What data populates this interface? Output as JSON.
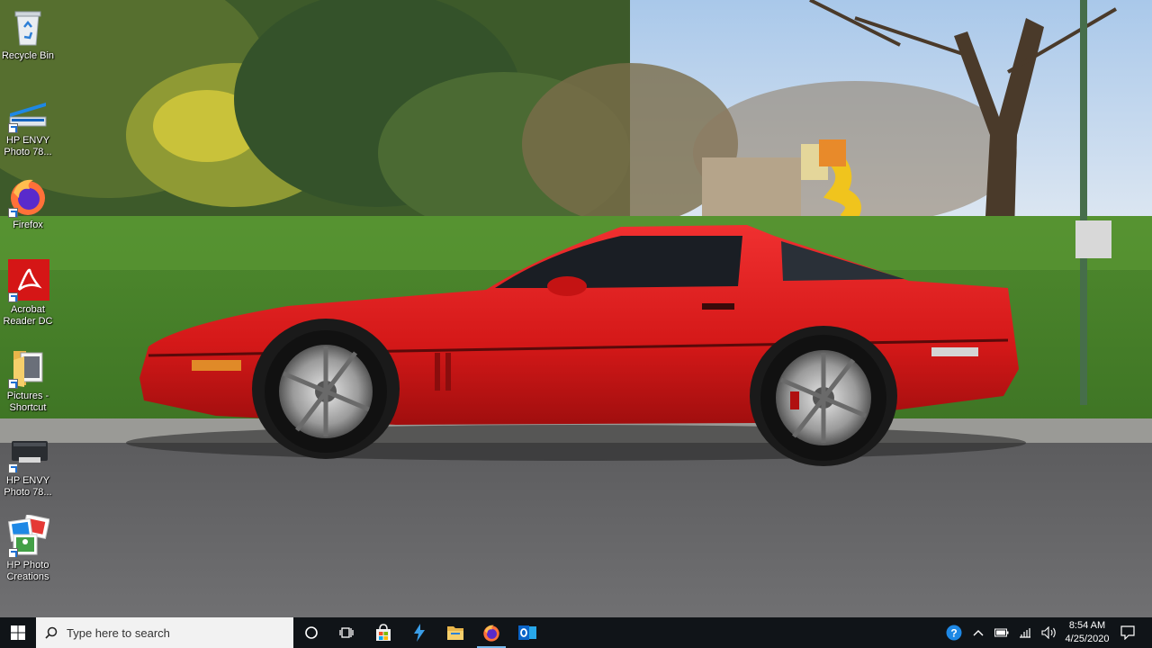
{
  "desktop": {
    "icons": [
      {
        "label": "Recycle Bin",
        "icon": "recycle-bin-icon"
      },
      {
        "label": "HP ENVY Photo 78...",
        "icon": "hp-scanner-icon"
      },
      {
        "label": "Firefox",
        "icon": "firefox-icon"
      },
      {
        "label": "Acrobat Reader DC",
        "icon": "acrobat-icon"
      },
      {
        "label": "Pictures - Shortcut",
        "icon": "folder-icon"
      },
      {
        "label": "HP ENVY Photo 78...",
        "icon": "printer-icon"
      },
      {
        "label": "HP Photo Creations",
        "icon": "hp-photo-creations-icon"
      }
    ]
  },
  "taskbar": {
    "search_placeholder": "Type here to search",
    "apps": [
      "cortana-icon",
      "task-view-icon",
      "store-icon",
      "bolt-app-icon",
      "file-explorer-icon",
      "firefox-icon",
      "outlook-icon"
    ],
    "active_app": "firefox-icon",
    "clock": {
      "time": "8:54 AM",
      "date": "4/25/2020"
    }
  },
  "colors": {
    "taskbar": "#101418",
    "accent": "#76b9ed",
    "car": "#d81a1a"
  }
}
